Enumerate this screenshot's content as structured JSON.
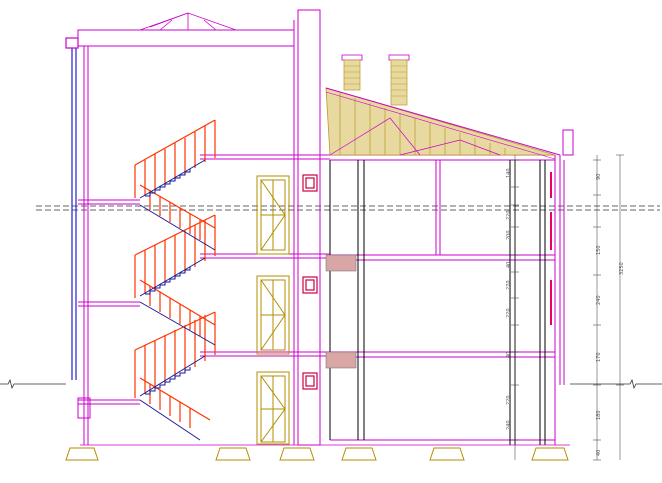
{
  "colors": {
    "background": "#ffffff",
    "structure": "#cc00cc",
    "structure_light": "#ff55ff",
    "stair": "#ff3300",
    "stair_tread": "#1a1a99",
    "door": "#b38f00",
    "roof_truss": "#b89a2a",
    "roof_hatch": "#e8d9a0",
    "ground": "#333333",
    "dimension": "#555555",
    "column_blue": "#2222cc",
    "insulation": "#d9a6a6",
    "wall_dark": "#000000",
    "footing": "#b38f00",
    "window_red": "#ee0055"
  },
  "dimensions": {
    "left_column": [
      "140",
      "220",
      "200",
      "40",
      "270",
      "220",
      "40",
      "220",
      "240"
    ],
    "right_column": [
      "90",
      "150",
      "240",
      "170",
      "180",
      "40"
    ],
    "outer_column": [
      "3250"
    ]
  },
  "level_markers": [
    "+",
    "+",
    "+",
    "±0"
  ]
}
